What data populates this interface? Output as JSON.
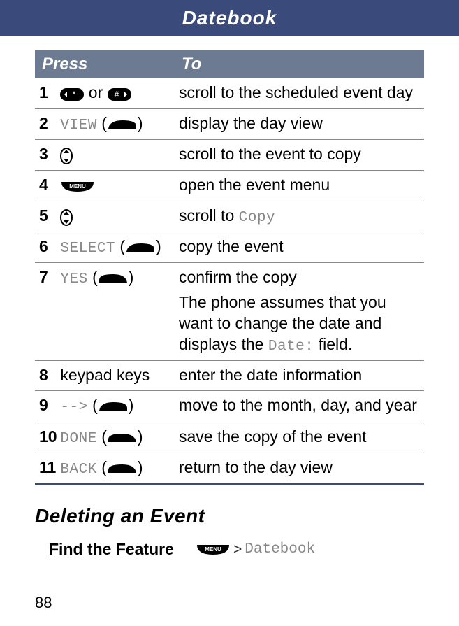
{
  "header": {
    "title": "Datebook"
  },
  "table": {
    "headers": {
      "press": "Press",
      "to": "To"
    },
    "rows": [
      {
        "num": "1",
        "press_text_before": "",
        "press_soft": "",
        "press_text_after": " or ",
        "icon1": "star-key",
        "icon2": "hash-key",
        "to": "scroll to the scheduled event day"
      },
      {
        "num": "2",
        "press_soft": "VIEW",
        "icon": "right-soft",
        "to": "display the day view"
      },
      {
        "num": "3",
        "icon": "nav-scroll",
        "to": "scroll to the event to copy"
      },
      {
        "num": "4",
        "icon": "menu-key",
        "to": "open the event menu"
      },
      {
        "num": "5",
        "icon": "nav-scroll",
        "to": "scroll to ",
        "to_soft": "Copy"
      },
      {
        "num": "6",
        "press_soft": "SELECT",
        "icon": "right-soft",
        "to": "copy the event"
      },
      {
        "num": "7",
        "press_soft": "YES",
        "icon": "left-soft",
        "to": "confirm the copy",
        "extra": "The phone assumes that you want to change the date and displays the ",
        "extra_soft": "Date:",
        "extra_after": " field."
      },
      {
        "num": "8",
        "press_text": "keypad keys",
        "to": "enter the date information"
      },
      {
        "num": "9",
        "press_soft": " -->",
        "icon": "right-soft",
        "to": "move to the month, day, and year"
      },
      {
        "num": "10",
        "press_soft": " DONE",
        "icon": "left-soft",
        "to": "save the copy of the event"
      },
      {
        "num": "11",
        "press_soft": " BACK",
        "icon": "left-soft",
        "to": "return to the day view"
      }
    ]
  },
  "section": {
    "heading": "Deleting an Event"
  },
  "find": {
    "label": "Find the Feature",
    "icon": "menu-key",
    "gt": ">",
    "path": "Datebook"
  },
  "page_number": "88"
}
